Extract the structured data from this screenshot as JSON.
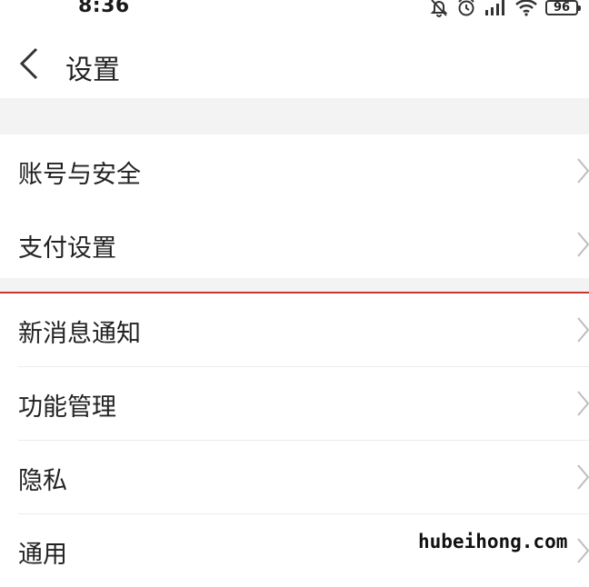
{
  "status_bar": {
    "time": "8:36",
    "battery": "96",
    "icons": [
      "notifications-muted-icon",
      "alarm-icon",
      "signal-icon",
      "wifi-icon",
      "battery-icon"
    ]
  },
  "header": {
    "back_icon": "chevron-left-icon",
    "title": "设置"
  },
  "menu": {
    "items": [
      {
        "label": "账号与安全"
      },
      {
        "label": "支付设置"
      },
      {
        "label": "新消息通知"
      },
      {
        "label": "功能管理"
      },
      {
        "label": "隐私"
      },
      {
        "label": "通用"
      }
    ]
  },
  "highlight_color": "#c9362f",
  "watermark": "hubeihong.com"
}
